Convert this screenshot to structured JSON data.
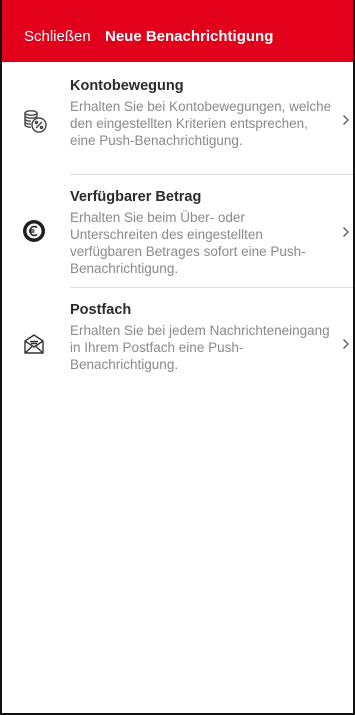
{
  "header": {
    "close_label": "Schließen",
    "title": "Neue Benachrichtigung",
    "color": "#e2001a"
  },
  "items": [
    {
      "title": "Kontobewegung",
      "description": "Erhalten Sie bei Kontobewegungen, welche den eingestellten Kriterien entsprechen, eine Push-Benachrichtigung.",
      "icon": "coins-percent-icon"
    },
    {
      "title": "Verfügbarer Betrag",
      "description": "Erhalten Sie beim Über- oder Unterschreiten des eingestellten verfügbaren Betrages sofort eine Push-Benachrichtigung.",
      "icon": "euro-coin-icon"
    },
    {
      "title": "Postfach",
      "description": "Erhalten Sie bei jedem Nachrichteneingang in Ihrem Postfach eine Push-Benachrichtigung.",
      "icon": "envelope-icon"
    }
  ]
}
